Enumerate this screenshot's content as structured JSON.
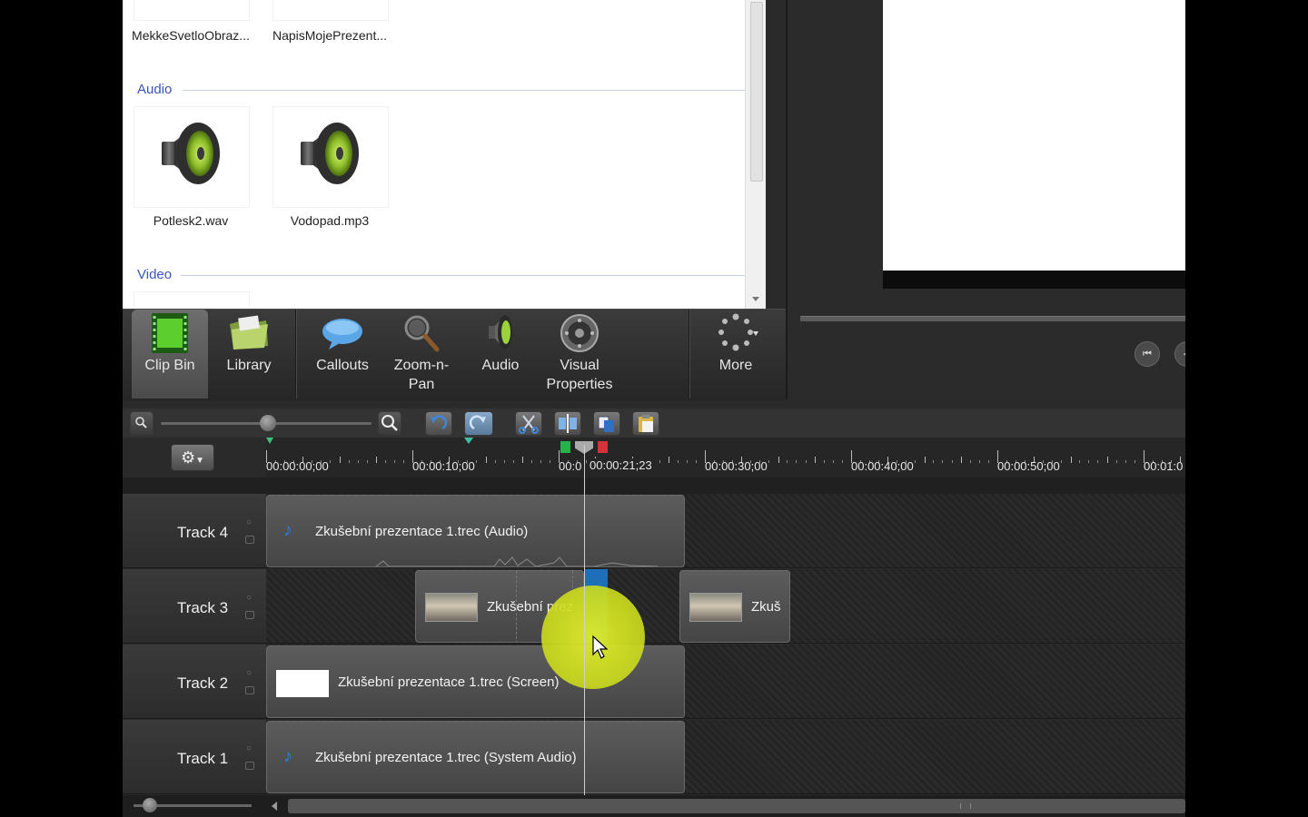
{
  "clip_bin": {
    "top_items": [
      "MekkeSvetloObraz...",
      "NapisMojePrezent..."
    ],
    "audio_section": "Audio",
    "audio_items": [
      "Potlesk2.wav",
      "Vodopad.mp3"
    ],
    "video_section": "Video"
  },
  "tools": {
    "clip_bin": "Clip Bin",
    "library": "Library",
    "callouts": "Callouts",
    "zoom_line1": "Zoom-n-",
    "zoom_line2": "Pan",
    "audio": "Audio",
    "visual_line1": "Visual",
    "visual_line2": "Properties",
    "more": "More"
  },
  "ruler": {
    "labels": [
      "00:00:00;00",
      "00:00:10;00",
      "00:0",
      "00:00:30;00",
      "00:00:40;00",
      "00:00:50;00",
      "00:01:0"
    ],
    "playhead_time": "00:00:21;23"
  },
  "tracks": [
    {
      "name": "Track 4",
      "clips": [
        "Zkušební prezentace 1.trec (Audio)"
      ]
    },
    {
      "name": "Track 3",
      "clips": [
        "Zkušební prez",
        "Zkuš"
      ]
    },
    {
      "name": "Track 2",
      "clips": [
        "Zkušební prezentace 1.trec (Screen)"
      ]
    },
    {
      "name": "Track 1",
      "clips": [
        "Zkušební prezentace 1.trec (System Audio)"
      ]
    }
  ],
  "colors": {
    "section_header": "#3a55b5",
    "audio_note": "#2a7ed8",
    "highlight": "#d9e62a"
  },
  "icons": [
    "film-icon",
    "folder-icon",
    "speech-bubble-icon",
    "magnifier-icon",
    "speaker-icon",
    "reel-icon",
    "spinner-icon",
    "undo-icon",
    "redo-icon",
    "cut-icon",
    "split-icon",
    "copy-icon",
    "paste-icon",
    "gear-icon"
  ]
}
